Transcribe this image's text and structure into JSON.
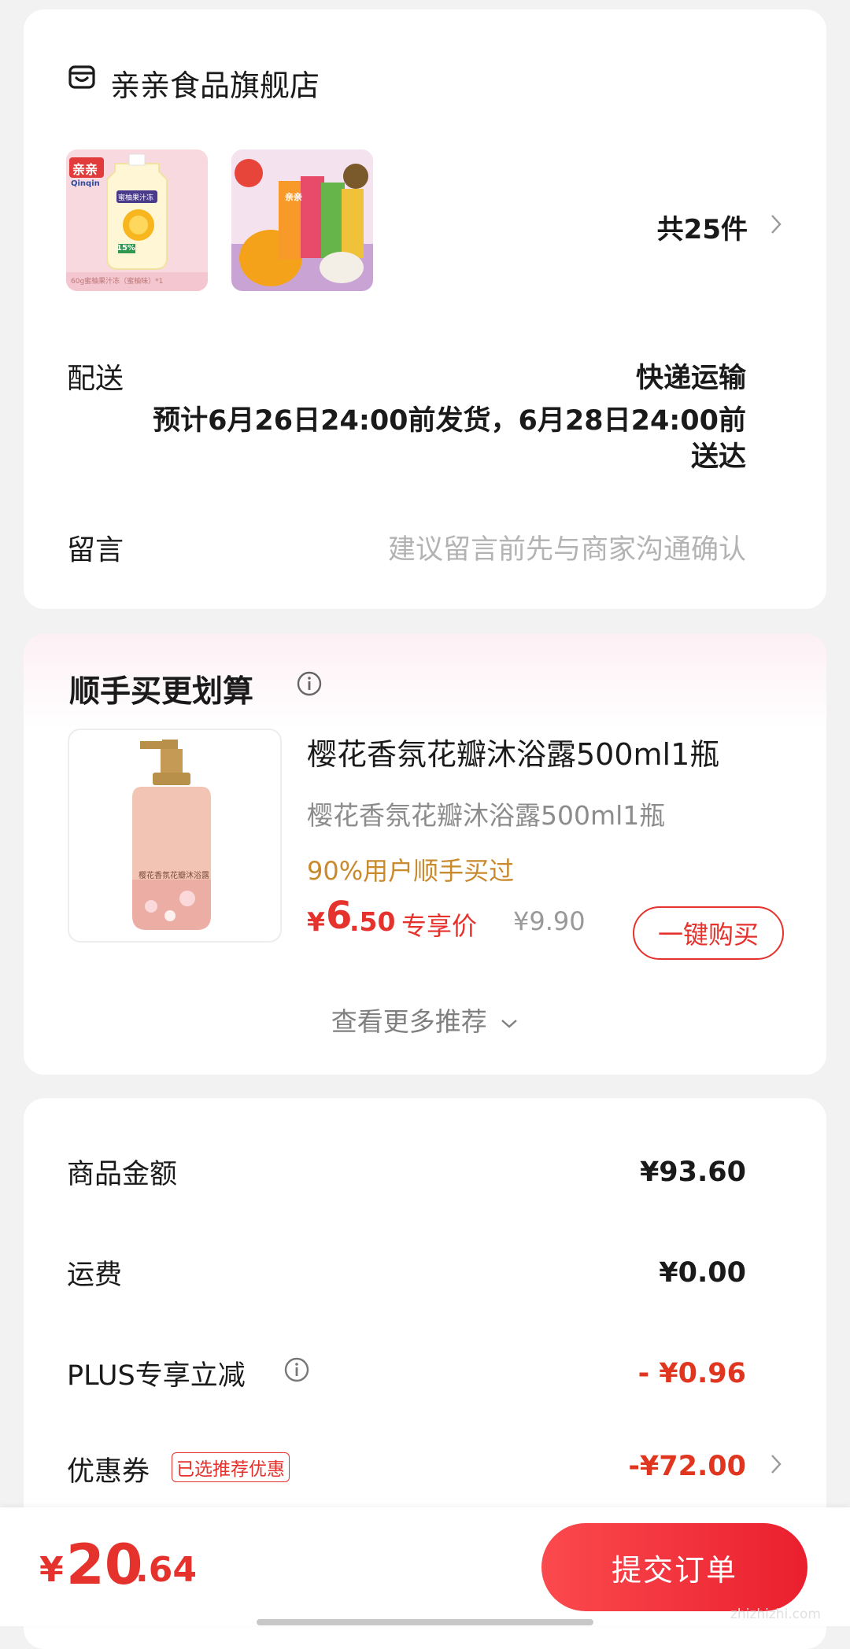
{
  "store": {
    "name": "亲亲食品旗舰店",
    "item_count_label": "共25件",
    "product_thumbs": [
      {
        "brand_logo_text": "亲亲",
        "brand_latin": "Qinqin",
        "package_label": "蜜柚果汁冻",
        "percent": "15%",
        "caption": "60g蜜柚果汁冻（蜜柚味）*1"
      },
      {
        "brand_logo_text": "亲亲"
      }
    ]
  },
  "delivery": {
    "label": "配送",
    "method": "快递运输",
    "estimate_line1": "预计6月26日24:00前发货，6月28日24:00前",
    "estimate_line2": "送达"
  },
  "message": {
    "label": "留言",
    "placeholder": "建议留言前先与商家沟通确认"
  },
  "addon": {
    "title": "顺手买更划算",
    "product": {
      "name": "樱花香氛花瓣沐浴露500ml1瓶",
      "subtitle": "樱花香氛花瓣沐浴露500ml1瓶",
      "badge": "90%用户顺手买过",
      "price_currency": "¥",
      "price_int": "6",
      "price_dec": ".50",
      "price_tag": "专享价",
      "original_price": "¥9.90",
      "buy_label": "一键购买",
      "bottle_label": "樱花香氛花瓣沐浴露"
    },
    "more_label": "查看更多推荐"
  },
  "summary": {
    "rows": [
      {
        "label": "商品金额",
        "value": "¥93.60"
      },
      {
        "label": "运费",
        "value": "¥0.00"
      },
      {
        "label": "PLUS专享立减",
        "value": "- ¥0.96"
      },
      {
        "label": "优惠券",
        "tag": "已选推荐优惠",
        "value": "-¥72.00"
      }
    ]
  },
  "footer": {
    "currency": "¥",
    "total_int": "20",
    "total_dec": ".64",
    "submit_label": "提交订单",
    "watermark": "zhizhizhi.com"
  },
  "colors": {
    "accent_red": "#e5322d",
    "badge_gold": "#c88a2d",
    "background": "#f2f2f2"
  }
}
